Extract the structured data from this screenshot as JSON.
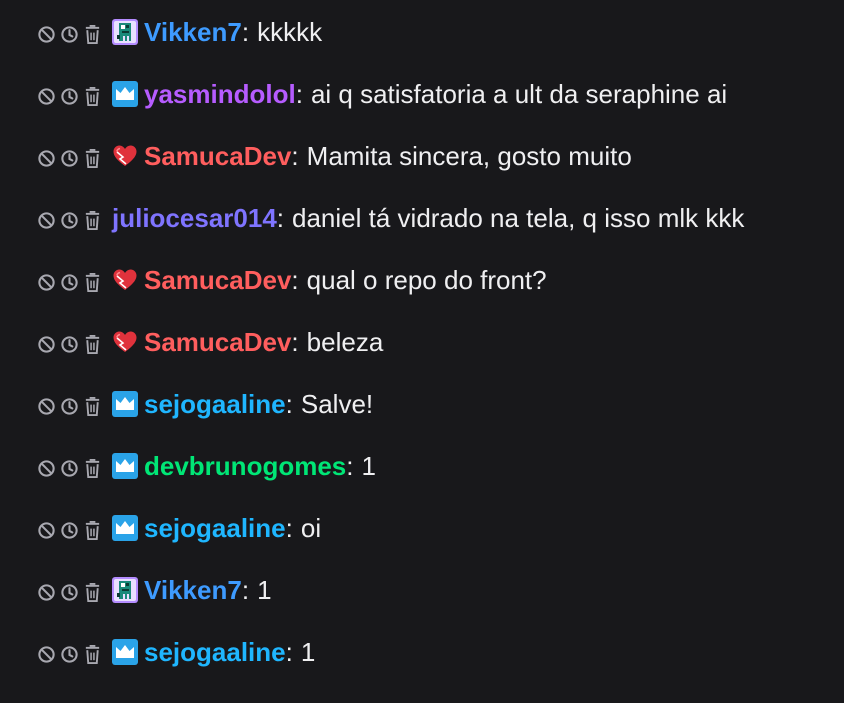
{
  "colors": {
    "background": "#18181b",
    "text": "#efeff1",
    "icon": "#a8a8b0"
  },
  "mod_actions": {
    "ban_icon": "ban-icon",
    "timeout_icon": "clock-icon",
    "delete_icon": "trash-icon"
  },
  "messages": [
    {
      "badge": "pixel-character-badge-icon",
      "user": "Vikken7",
      "user_color": "#3e9bff",
      "separator": ":",
      "text": "kkkkk"
    },
    {
      "badge": "prime-crown-badge-icon",
      "user": "yasmindolol",
      "user_color": "#b65cff",
      "separator": ":",
      "text": "ai q satisfatoria a ult da seraphine ai"
    },
    {
      "badge": "heart-badge-icon",
      "user": "SamucaDev",
      "user_color": "#ff5e5e",
      "separator": ":",
      "text": "Mamita sincera, gosto muito"
    },
    {
      "badge": "",
      "user": "juliocesar014",
      "user_color": "#7f74ff",
      "separator": ":",
      "text": "daniel tá vidrado na tela, q isso mlk kkk"
    },
    {
      "badge": "heart-badge-icon",
      "user": "SamucaDev",
      "user_color": "#ff5e5e",
      "separator": ":",
      "text": "qual o repo do front?"
    },
    {
      "badge": "heart-badge-icon",
      "user": "SamucaDev",
      "user_color": "#ff5e5e",
      "separator": ":",
      "text": "beleza"
    },
    {
      "badge": "prime-crown-badge-icon",
      "user": "sejogaaline",
      "user_color": "#1fb6ff",
      "separator": ":",
      "text": "Salve!"
    },
    {
      "badge": "prime-crown-badge-icon",
      "user": "devbrunogomes",
      "user_color": "#00e676",
      "separator": ":",
      "text": "1"
    },
    {
      "badge": "prime-crown-badge-icon",
      "user": "sejogaaline",
      "user_color": "#1fb6ff",
      "separator": ":",
      "text": "oi"
    },
    {
      "badge": "pixel-character-badge-icon",
      "user": "Vikken7",
      "user_color": "#3e9bff",
      "separator": ":",
      "text": "1"
    },
    {
      "badge": "prime-crown-badge-icon",
      "user": "sejogaaline",
      "user_color": "#1fb6ff",
      "separator": ":",
      "text": "1"
    }
  ]
}
